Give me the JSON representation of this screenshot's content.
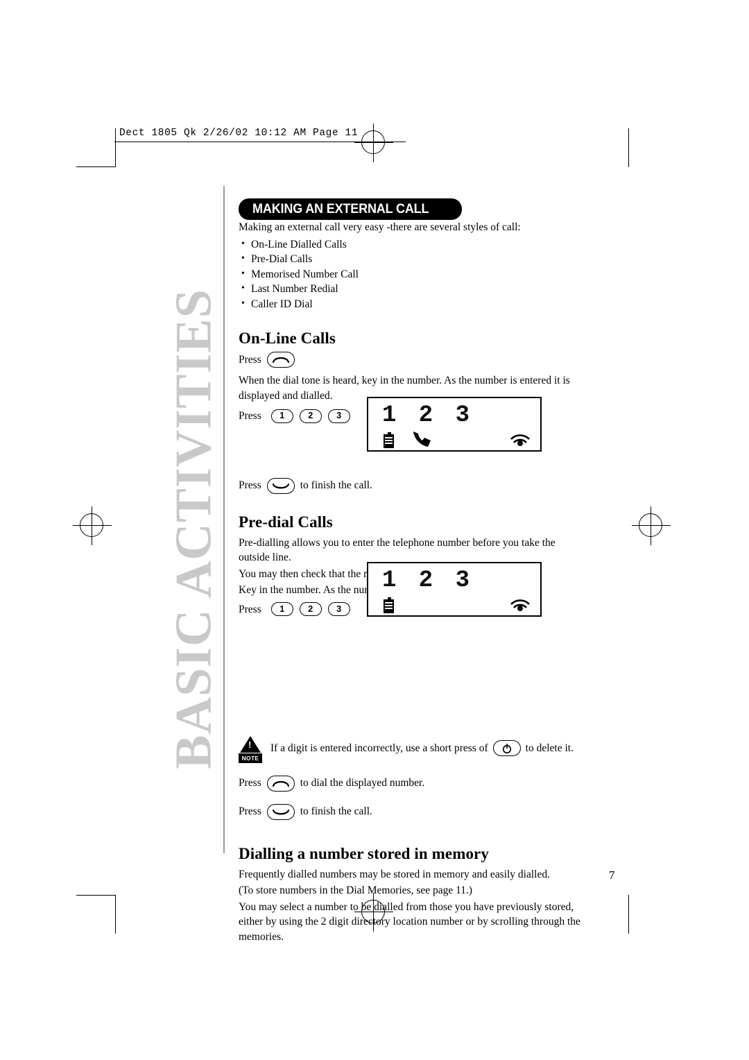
{
  "document": {
    "slug": "Dect 1805 Qk  2/26/02  10:12 AM  Page 11",
    "side_title": "BASIC ACTIVITIES",
    "page_number": "7",
    "banner": "MAKING AN EXTERNAL CALL",
    "intro": "Making an external call very easy -there are several styles of call:",
    "bullets": [
      "On-Line Dialled Calls",
      "Pre-Dial Calls",
      "Memorised Number Call",
      "Last Number Redial",
      "Caller ID Dial"
    ],
    "sections": [
      {
        "heading": "On-Line Calls",
        "press_label": "Press",
        "talk_key_icon": "talk-key-icon",
        "paragraph": "When the dial tone is heard, key in the number. As the number is entered it is displayed and dialled.",
        "press_keys_label": "Press",
        "keys": [
          "1",
          "2",
          "3"
        ],
        "end_press_label": "Press",
        "end_press_text": "to finish the call.",
        "end_key_icon": "end-call-key-icon",
        "lcd": {
          "digits": "1 2 3",
          "battery_icon": "battery-icon",
          "handset_icon": "handset-in-call-icon",
          "antenna_icon": "signal-icon"
        }
      },
      {
        "heading": "Pre-dial Calls",
        "paragraphs": [
          "Pre-dialling allows you to enter the telephone number before you take the outside line.",
          "You may then check that the number is correct before dialling.",
          "Key in the number. As the number is entered it is displayed."
        ],
        "press_keys_label": "Press",
        "keys": [
          "1",
          "2",
          "3"
        ],
        "lcd": {
          "digits": "1 2 3",
          "battery_icon": "battery-icon",
          "antenna_icon": "signal-icon"
        },
        "note": {
          "badge": "NOTE",
          "text_before": "If a digit is entered incorrectly, use a short press of",
          "key_icon": "clear-key-icon",
          "text_after": "to delete it."
        },
        "dial_press_label": "Press",
        "dial_press_text": "to dial the displayed number.",
        "dial_key_icon": "talk-key-icon",
        "end_press_label": "Press",
        "end_press_text": "to finish the call.",
        "end_key_icon": "end-call-key-icon"
      },
      {
        "heading": "Dialling a number stored in memory",
        "paragraphs": [
          "Frequently dialled numbers may be stored in memory and easily dialled.",
          "(To store numbers in the Dial Memories, see page 11.)",
          "You may select a number to be dialled from those you have previously stored, either by using the 2 digit directory location number or by scrolling through the memories."
        ]
      }
    ]
  }
}
